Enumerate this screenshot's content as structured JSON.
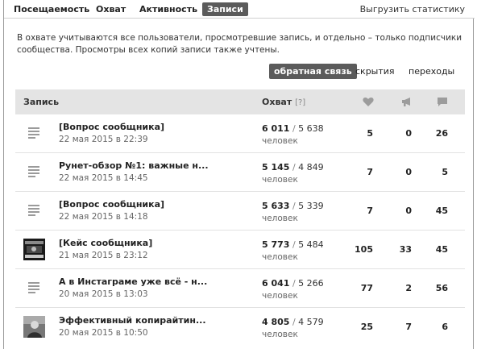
{
  "tabs": [
    {
      "label": "Посещаемость"
    },
    {
      "label": "Охват"
    },
    {
      "label": "Активность"
    },
    {
      "label": "Записи"
    }
  ],
  "export_label": "Выгрузить статистику",
  "info_text": "В охвате учитываются все пользователи, просмотревшие запись, и отдельно – только подписчики сообщества. Просмотры всех копий записи также учтены.",
  "toggles": [
    {
      "label": "обратная связь",
      "active": true
    },
    {
      "label": "скрытия",
      "active": false
    },
    {
      "label": "переходы",
      "active": false
    }
  ],
  "table": {
    "col_post": "Запись",
    "col_reach": "Охват",
    "col_reach_hint": "[?]",
    "col_likes_icon": "heart-icon",
    "col_reposts_icon": "megaphone-icon",
    "col_comments_icon": "comment-icon",
    "people_label": "человек",
    "rows": [
      {
        "title": "[Вопрос сообщника]",
        "date": "22 мая 2015 в 22:39",
        "reach_total": "6 011",
        "reach_subs": "5 638",
        "likes": "5",
        "reposts": "0",
        "comments": "26",
        "thumb": "doc-icon"
      },
      {
        "title": "Рунет-обзор №1: важные н...",
        "date": "22 мая 2015 в 14:45",
        "reach_total": "5 145",
        "reach_subs": "4 849",
        "likes": "7",
        "reposts": "0",
        "comments": "5",
        "thumb": "doc-icon"
      },
      {
        "title": "[Вопрос сообщника]",
        "date": "22 мая 2015 в 14:18",
        "reach_total": "5 633",
        "reach_subs": "5 339",
        "likes": "7",
        "reposts": "0",
        "comments": "45",
        "thumb": "doc-icon"
      },
      {
        "title": "[Кейс сообщника]",
        "date": "21 мая 2015 в 23:12",
        "reach_total": "5 773",
        "reach_subs": "5 484",
        "likes": "105",
        "reposts": "33",
        "comments": "45",
        "thumb": "image"
      },
      {
        "title": "А в Инстаграме уже всё - н...",
        "date": "20 мая 2015 в 13:03",
        "reach_total": "6 041",
        "reach_subs": "5 266",
        "likes": "77",
        "reposts": "2",
        "comments": "56",
        "thumb": "doc-icon"
      },
      {
        "title": "Эффективный копирайтин...",
        "date": "20 мая 2015 в 10:50",
        "reach_total": "4 805",
        "reach_subs": "4 579",
        "likes": "25",
        "reposts": "7",
        "comments": "6",
        "thumb": "photo"
      }
    ]
  }
}
